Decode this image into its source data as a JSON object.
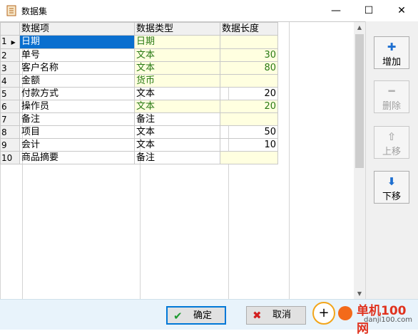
{
  "window": {
    "title": "数据集",
    "minimize": "—",
    "maximize": "☐",
    "close": "✕"
  },
  "grid": {
    "columns": [
      "数据项",
      "数据类型",
      "数据长度"
    ],
    "current_row_marker": "▶",
    "rows": [
      {
        "n": "1",
        "item": "日期",
        "type": "日期",
        "len": ""
      },
      {
        "n": "2",
        "item": "单号",
        "type": "文本",
        "len": "30"
      },
      {
        "n": "3",
        "item": "客户名称",
        "type": "文本",
        "len": "80"
      },
      {
        "n": "4",
        "item": "金额",
        "type": "货币",
        "len": ""
      },
      {
        "n": "5",
        "item": "付款方式",
        "type": "文本",
        "len": "20"
      },
      {
        "n": "6",
        "item": "操作员",
        "type": "文本",
        "len": "20"
      },
      {
        "n": "7",
        "item": "备注",
        "type": "备注",
        "len": ""
      },
      {
        "n": "8",
        "item": "项目",
        "type": "文本",
        "len": "50"
      },
      {
        "n": "9",
        "item": "会计",
        "type": "文本",
        "len": "10"
      },
      {
        "n": "10",
        "item": "商品摘要",
        "type": "备注",
        "len": ""
      }
    ]
  },
  "scrollbar": {
    "up": "▲",
    "down": "▼"
  },
  "side": {
    "add": {
      "label": "增加",
      "icon": "✚"
    },
    "delete": {
      "label": "删除",
      "icon": "━"
    },
    "up": {
      "label": "上移",
      "icon": "⇧"
    },
    "down": {
      "label": "下移",
      "icon": "⬇"
    }
  },
  "footer": {
    "ok": {
      "label": "确定",
      "icon": "✔"
    },
    "cancel": {
      "label": "取消",
      "icon": "✖"
    }
  },
  "watermark": {
    "text": "单机100网",
    "url": "danji100.com",
    "logo_glyph": "+"
  },
  "colors": {
    "selected": "#0a6fcf",
    "highlight": "#ffffe0",
    "green_text": "#2a7a14",
    "accent": "#0078d7"
  }
}
